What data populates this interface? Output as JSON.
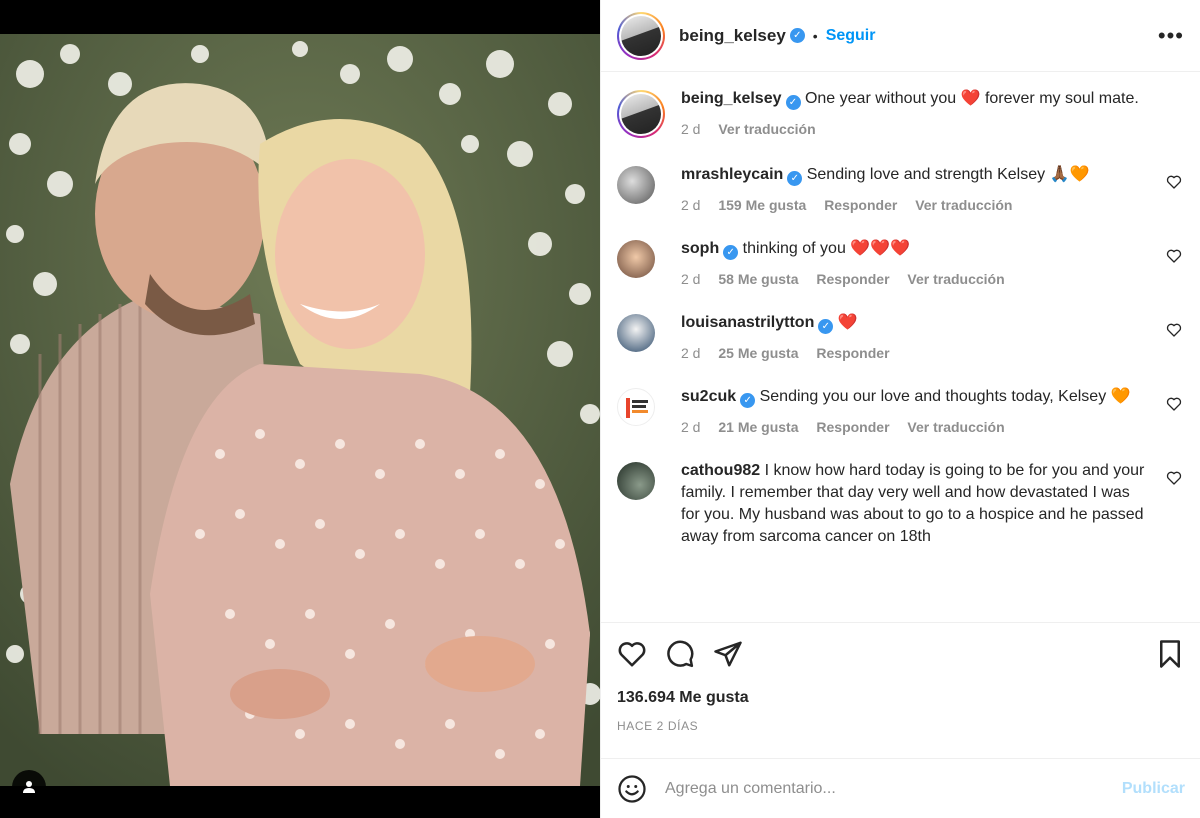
{
  "post": {
    "username": "being_kelsey",
    "follow_label": "Seguir",
    "more_label": "•••",
    "dot": "•"
  },
  "caption": {
    "username": "being_kelsey",
    "text": "One year without you ❤️ forever my soul mate.",
    "time": "2 d",
    "translate": "Ver traducción"
  },
  "comments": [
    {
      "username": "mrashleycain",
      "verified": true,
      "text": "Sending love and strength Kelsey 🙏🏾🧡",
      "time": "2 d",
      "likes": "159 Me gusta",
      "reply": "Responder",
      "translate": "Ver traducción"
    },
    {
      "username": "soph",
      "verified": true,
      "text": "thinking of you ❤️❤️❤️",
      "time": "2 d",
      "likes": "58 Me gusta",
      "reply": "Responder",
      "translate": "Ver traducción"
    },
    {
      "username": "louisanastrilytton",
      "verified": true,
      "text": "❤️",
      "time": "2 d",
      "likes": "25 Me gusta",
      "reply": "Responder"
    },
    {
      "username": "su2cuk",
      "verified": true,
      "text": "Sending you our love and thoughts today, Kelsey 🧡",
      "time": "2 d",
      "likes": "21 Me gusta",
      "reply": "Responder",
      "translate": "Ver traducción"
    },
    {
      "username": "cathou982",
      "verified": false,
      "text": "I know how hard today is going to be for you and your family. I remember that day very well and how devastated I was for you. My husband was about to go to a hospice and he passed away from sarcoma cancer on 18th"
    }
  ],
  "footer": {
    "likes": "136.694 Me gusta",
    "posted": "HACE 2 DÍAS",
    "comment_placeholder": "Agrega un comentario...",
    "publish_label": "Publicar"
  },
  "colors": {
    "link_blue": "#0095f6",
    "verified_blue": "#3897f0",
    "muted": "#8e8e8e",
    "publish_disabled": "#b2dffc"
  },
  "icons": [
    "user-tag-icon",
    "verified-icon",
    "more-icon",
    "heart-icon",
    "comment-icon",
    "share-icon",
    "bookmark-icon",
    "emoji-icon"
  ]
}
